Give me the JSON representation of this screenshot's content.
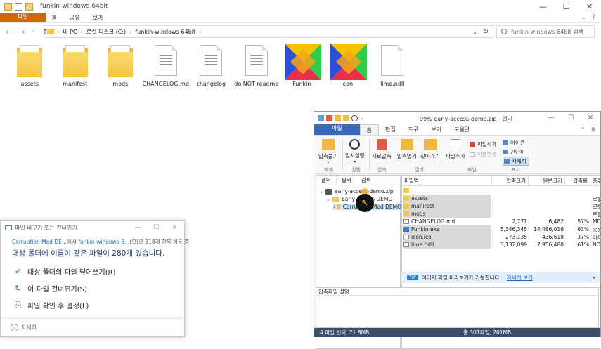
{
  "explorer": {
    "title": "funkin-windows-64bit",
    "tabs": [
      "파일",
      "홈",
      "공유",
      "보기"
    ],
    "breadcrumb": [
      "내 PC",
      "로컬 디스크 (C:)",
      "funkin-windows-64bit"
    ],
    "search_placeholder": "funkin-windows-64bit 검색",
    "files": [
      {
        "name": "assets",
        "kind": "folder"
      },
      {
        "name": "manifest",
        "kind": "folder"
      },
      {
        "name": "mods",
        "kind": "folder"
      },
      {
        "name": "CHANGELOG.md",
        "kind": "doc"
      },
      {
        "name": "changelog",
        "kind": "doc"
      },
      {
        "name": "do NOT readme",
        "kind": "doc"
      },
      {
        "name": "Funkin",
        "kind": "haxe"
      },
      {
        "name": "icon",
        "kind": "haxe"
      },
      {
        "name": "lime.ndll",
        "kind": "doc"
      }
    ]
  },
  "copy_dialog": {
    "title": "파일 바꾸기 또는 건너뛰기",
    "source_link": "Corruption Mod DE...",
    "source_mid": "에서",
    "dest_link": "funkin-windows-6...",
    "source_tail": "(으)로 318개 항목 이동 중",
    "message": "대상 폴더에 이름이 같은 파일이 280개 있습니다.",
    "options": [
      {
        "label": "대상 폴더의 파일 덮어쓰기(R)",
        "glyph": "✔",
        "color": "#2e9e3e"
      },
      {
        "label": "이 파일 건너뛰기(S)",
        "glyph": "↻",
        "color": "#2b6cb8"
      },
      {
        "label": "파일 확인 후 결정(L)",
        "glyph": "⎘",
        "color": "#555555"
      }
    ],
    "details": "자세히"
  },
  "bandizip": {
    "title": "99% early-access-demo.zip - 열기",
    "tabs": [
      "파일",
      "홈",
      "편집",
      "도구",
      "보기",
      "도움말"
    ],
    "ribbon": {
      "buttons": [
        {
          "label": "압축풀기",
          "sub": "▾"
        },
        {
          "label": "임시실행",
          "sub": "▾"
        },
        {
          "label": "새로압축",
          "sub": ""
        },
        {
          "label": "압축열기",
          "sub": ""
        },
        {
          "label": "찾아가기",
          "sub": ""
        },
        {
          "label": "파일추가",
          "sub": ""
        }
      ],
      "small": [
        "파일삭제",
        "이름변경"
      ],
      "view": [
        "아이콘",
        "간단히",
        "자세히"
      ],
      "groups": [
        "해제",
        "실행",
        "압축",
        "열기",
        "파일",
        "표시"
      ]
    },
    "left_tabs": [
      "폴더",
      "필터",
      "검색"
    ],
    "tree": [
      {
        "label": "early-access-demo.zip",
        "level": 0
      },
      {
        "label": "Early Access DEMO",
        "level": 1
      },
      {
        "label": "Corruption Mod DEMO",
        "level": 2
      }
    ],
    "columns": [
      "파일명",
      "압축크기",
      "원본크기",
      "압축률",
      "종류"
    ],
    "rows": [
      {
        "name": "..",
        "icon": "f",
        "packed": "",
        "size": "",
        "ratio": "",
        "type": "",
        "sel": false
      },
      {
        "name": "assets",
        "icon": "f",
        "packed": "",
        "size": "",
        "ratio": "",
        "type": "로컬",
        "sel": true
      },
      {
        "name": "manifest",
        "icon": "f",
        "packed": "",
        "size": "",
        "ratio": "",
        "type": "로컬",
        "sel": true
      },
      {
        "name": "mods",
        "icon": "f",
        "packed": "",
        "size": "",
        "ratio": "",
        "type": "로컬",
        "sel": true
      },
      {
        "name": "CHANGELOG.md",
        "icon": "d",
        "packed": "2,771",
        "size": "6,482",
        "ratio": "57%",
        "type": "MD",
        "sel": false
      },
      {
        "name": "Funkin.exe",
        "icon": "e",
        "packed": "5,346,345",
        "size": "14,486,016",
        "ratio": "63%",
        "type": "응용",
        "sel": true
      },
      {
        "name": "icon.ico",
        "icon": "d",
        "packed": "273,135",
        "size": "436,618",
        "ratio": "37%",
        "type": "아이",
        "sel": true
      },
      {
        "name": "lime.ndll",
        "icon": "d",
        "packed": "3,132,099",
        "size": "7,956,480",
        "ratio": "61%",
        "type": "NDI",
        "sel": true
      }
    ],
    "tip": {
      "badge": "TIP",
      "text": "이미지 파일 미리보기가 가능합니다.",
      "link": "자세히 보기"
    },
    "comment_header": "압축파일 설명",
    "status_left": "4 파일 선택, 21.8MB",
    "status_center": "총 301파일, 201MB"
  }
}
